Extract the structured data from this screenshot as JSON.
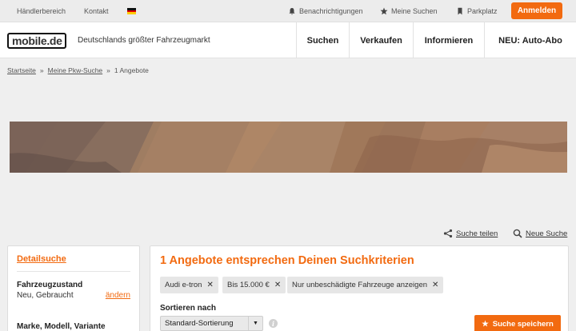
{
  "topbar": {
    "dealer_area": "Händlerbereich",
    "contact": "Kontakt",
    "language_flag": "de-flag-icon",
    "notifications": "Benachrichtigungen",
    "my_searches": "Meine Suchen",
    "parking": "Parkplatz",
    "login": "Anmelden"
  },
  "header": {
    "logo_text": "mobile.de",
    "tagline": "Deutschlands größter Fahrzeugmarkt",
    "nav": [
      "Suchen",
      "Verkaufen",
      "Informieren",
      "NEU: Auto-Abo"
    ]
  },
  "breadcrumb": {
    "home": "Startseite",
    "sep": "»",
    "search": "Meine Pkw-Suche",
    "current": "1 Angebote"
  },
  "actions": {
    "share": "Suche teilen",
    "new_search": "Neue Suche"
  },
  "sidebar": {
    "title": "Detailsuche",
    "condition_label": "Fahrzeugzustand",
    "condition_value": "Neu, Gebraucht",
    "change": "ändern",
    "make_label": "Marke, Modell, Variante"
  },
  "results": {
    "title": "1 Angebote entsprechen Deinen Suchkriterien",
    "chips": [
      "Audi e-tron",
      "Bis 15.000 €",
      "Nur unbeschädigte Fahrzeuge anzeigen"
    ],
    "chip_remove": "✕",
    "sort_label": "Sortieren nach",
    "sort_value": "Standard-Sortierung",
    "info": "i",
    "save_search": "Suche speichern"
  },
  "colors": {
    "brand_orange": "#f26a10",
    "page_bg": "#efefef"
  }
}
